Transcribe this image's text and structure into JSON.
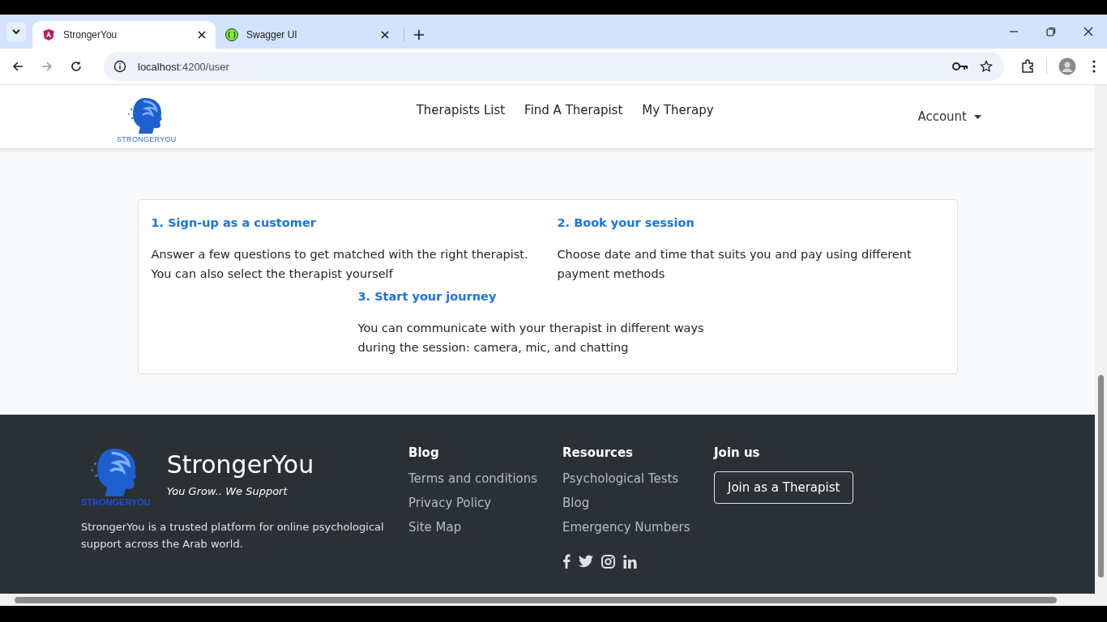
{
  "browser": {
    "tabs": [
      {
        "title": "StrongerYou",
        "selected": true,
        "kind": "angular"
      },
      {
        "title": "Swagger UI",
        "selected": false,
        "kind": "swagger"
      }
    ],
    "url_host": "localhost",
    "url_rest": ":4200/user"
  },
  "navbar": {
    "logo_text": "STRONGERYOU",
    "links": [
      "Therapists List",
      "Find A Therapist",
      "My Therapy"
    ],
    "account": "Account"
  },
  "how_it_works": {
    "steps": [
      {
        "title": "1. Sign-up as a customer",
        "text": "Answer a few questions to get matched with the right therapist. You can also select the therapist yourself"
      },
      {
        "title": "2. Book your session",
        "text": "Choose date and time that suits you and pay using different payment methods"
      },
      {
        "title": "3. Start your journey",
        "text": "You can communicate with your therapist in different ways during the session: camera, mic, and chatting"
      }
    ]
  },
  "footer": {
    "logo_text": "STRONGERYOU",
    "brand": "StrongerYou",
    "tagline": "You Grow.. We Support",
    "about": "StrongerYou is a trusted platform for online psychological support across the Arab world.",
    "columns": [
      {
        "title": "Blog",
        "links": [
          "Terms and conditions",
          "Privacy Policy",
          "Site Map"
        ]
      },
      {
        "title": "Resources",
        "links": [
          "Psychological Tests",
          "Blog",
          "Emergency Numbers"
        ]
      }
    ],
    "join_title": "Join us",
    "join_button": "Join as a Therapist",
    "social": [
      {
        "kind": "facebook"
      },
      {
        "kind": "twitter"
      },
      {
        "kind": "instagram"
      },
      {
        "kind": "linkedin"
      }
    ]
  }
}
